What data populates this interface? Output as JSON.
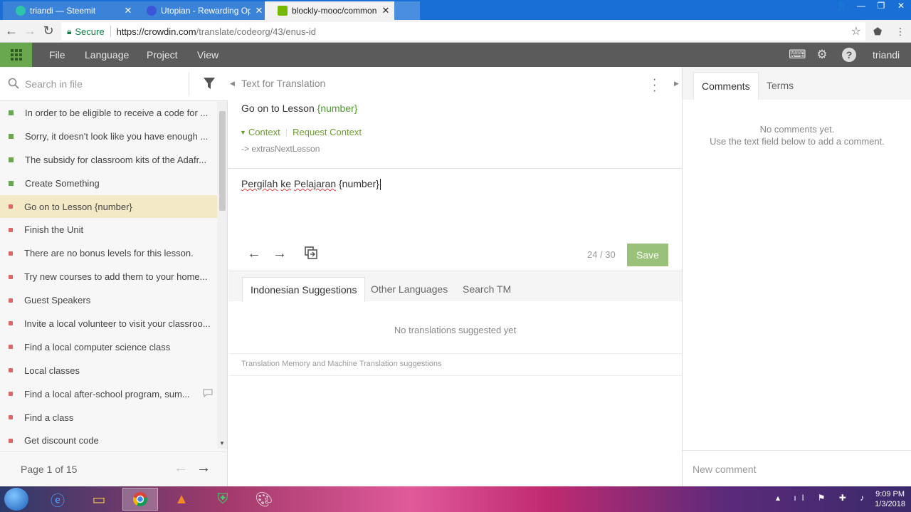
{
  "browser": {
    "tabs": [
      {
        "title": "triandi — Steemit",
        "color": "#2ec4a7"
      },
      {
        "title": "Utopian - Rewarding Op",
        "color": "#3b56d9"
      },
      {
        "title": "blockly-mooc/common.js",
        "color": "#76b900"
      }
    ],
    "secure_label": "Secure",
    "url_host": "https://crowdin.com",
    "url_path": "/translate/codeorg/43/enus-id",
    "user_label": "triandi"
  },
  "app": {
    "menu": [
      "File",
      "Language",
      "Project",
      "View"
    ],
    "user": "triandi",
    "accent": "#6aa84f"
  },
  "left": {
    "search_placeholder": "Search in file",
    "strings": [
      {
        "text": "In order to be eligible to receive a code for ...",
        "status": "translated",
        "comment": ""
      },
      {
        "text": "Sorry, it doesn't look like you have enough ...",
        "status": "translated",
        "comment": ""
      },
      {
        "text": "The subsidy for classroom kits of the Adafr...",
        "status": "translated",
        "comment": ""
      },
      {
        "text": "Create Something",
        "status": "translated",
        "comment": ""
      },
      {
        "text": "Go on to Lesson {number}",
        "status": "untranslated",
        "comment": ""
      },
      {
        "text": "Finish the Unit",
        "status": "untranslated",
        "comment": ""
      },
      {
        "text": "There are no bonus levels for this lesson.",
        "status": "untranslated",
        "comment": ""
      },
      {
        "text": "Try new courses to add them to your home...",
        "status": "untranslated",
        "comment": ""
      },
      {
        "text": "Guest Speakers",
        "status": "untranslated",
        "comment": ""
      },
      {
        "text": "Invite a local volunteer to visit your classroo...",
        "status": "untranslated",
        "comment": ""
      },
      {
        "text": "Find a local computer science class",
        "status": "untranslated",
        "comment": ""
      },
      {
        "text": "Local classes",
        "status": "untranslated",
        "comment": ""
      },
      {
        "text": "Find a local after-school program, sum...",
        "status": "untranslated",
        "comment": "comment-icon"
      },
      {
        "text": "Find a class",
        "status": "untranslated",
        "comment": ""
      },
      {
        "text": "Get discount code",
        "status": "untranslated",
        "comment": ""
      }
    ],
    "status_colors": {
      "translated": "#6aa84f",
      "untranslated": "#e06666"
    },
    "page_label": "Page 1 of 15"
  },
  "middle": {
    "heading": "Text for Translation",
    "source_text_plain": "Go on to Lesson ",
    "source_placeholder": "{number}",
    "context_label": "Context",
    "request_context_label": "Request Context",
    "context_key": "-> extrasNextLesson",
    "translation": {
      "w1": "Pergilah",
      "w2": "ke",
      "w3": "Pelajaran",
      "w4": "{number}"
    },
    "counter": "24 / 30",
    "save_label": "Save",
    "suggestion_tabs": [
      "Indonesian Suggestions",
      "Other Languages",
      "Search TM"
    ],
    "no_suggestions": "No translations suggested yet",
    "tm_note": "Translation Memory and Machine Translation suggestions"
  },
  "right": {
    "tabs": [
      "Comments",
      "Terms"
    ],
    "no_comments_line1": "No comments yet.",
    "no_comments_line2": "Use the text field below to add a comment.",
    "new_comment_placeholder": "New comment"
  },
  "taskbar": {
    "time": "9:09 PM",
    "date": "1/3/2018"
  }
}
